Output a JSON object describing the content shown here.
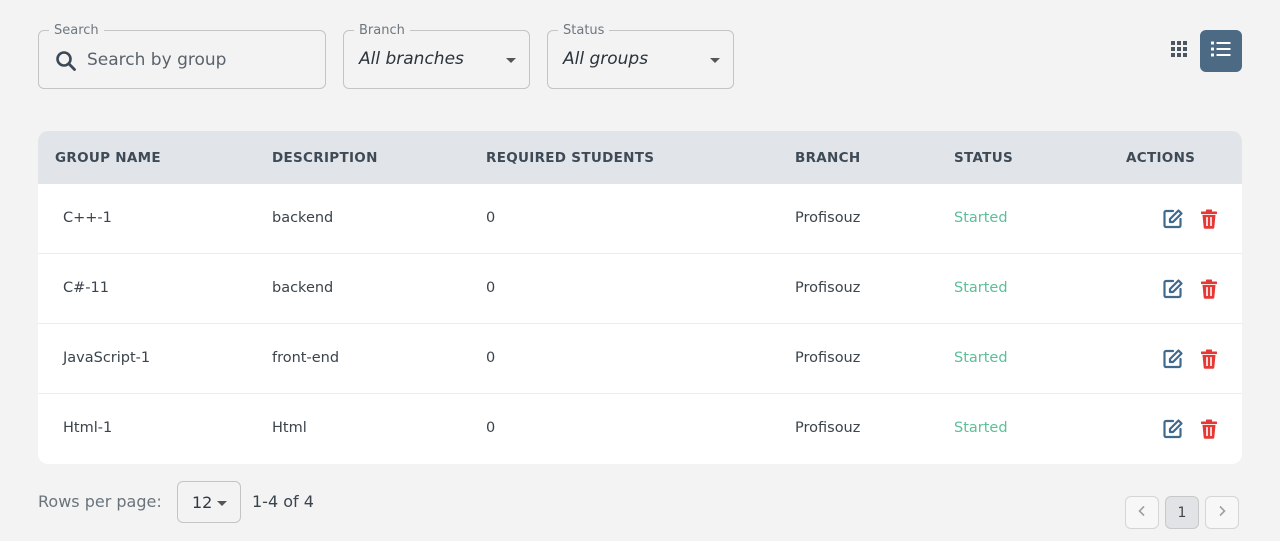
{
  "filters": {
    "search": {
      "label": "Search",
      "placeholder": "Search by group",
      "value": ""
    },
    "branch": {
      "label": "Branch",
      "value": "All branches"
    },
    "status": {
      "label": "Status",
      "value": "All groups"
    }
  },
  "view_toggle": {
    "active": "list",
    "icons": [
      "grid-icon",
      "list-icon"
    ]
  },
  "table": {
    "headers": [
      "GROUP NAME",
      "DESCRIPTION",
      "REQUIRED STUDENTS",
      "BRANCH",
      "STATUS",
      "ACTIONS"
    ],
    "rows": [
      {
        "group_name": "C++-1",
        "description": "backend",
        "required_students": "0",
        "branch": "Profisouz",
        "status": "Started"
      },
      {
        "group_name": "C#-11",
        "description": "backend",
        "required_students": "0",
        "branch": "Profisouz",
        "status": "Started"
      },
      {
        "group_name": "JavaScript-1",
        "description": "front-end",
        "required_students": "0",
        "branch": "Profisouz",
        "status": "Started"
      },
      {
        "group_name": "Html-1",
        "description": "Html",
        "required_students": "0",
        "branch": "Profisouz",
        "status": "Started"
      }
    ],
    "row_actions": [
      "edit-icon",
      "delete-icon"
    ]
  },
  "footer": {
    "rows_per_page_label": "Rows per page:",
    "rows_per_page_value": "12",
    "range": "1-4 of 4",
    "current_page": "1"
  },
  "colors": {
    "accent": "#4d6a84",
    "status_started": "#5cbf98",
    "delete": "#e53935",
    "edit": "#3f6a8e",
    "header_bg": "#e1e4e8"
  }
}
